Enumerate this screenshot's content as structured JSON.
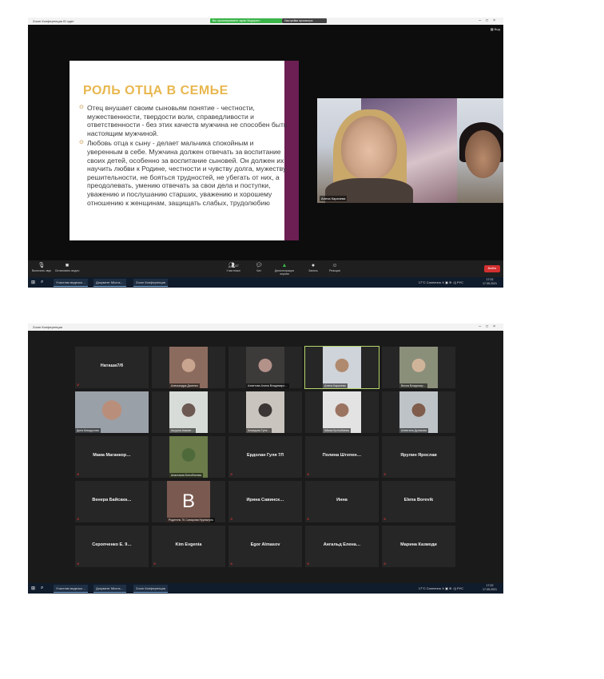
{
  "window1": {
    "title": "Zoom Конференция  ID идет",
    "share_banner": "Вы просматриваете экран Модерато",
    "share_options": "Настройки просмотра",
    "view_label": "Вид",
    "slide": {
      "title": "РОЛЬ ОТЦА В СЕМЬЕ",
      "bullets": [
        "Отец внушает своим сыновьям понятие - честности, мужественности, твердости воли, справедливости и ответственности - без этих качеств мужчина не способен быть настоящим мужчиной.",
        "Любовь отца к сыну - делает мальчика спокойным и уверенным в себе. Мужчина должен отвечать за воспитание своих детей, особенно за воспитание сыновей. Он должен их научить любви к Родине, честности и чувству долга, мужеству, решительности, не бояться трудностей, не убегать от них, а преодолевать, умению отвечать за свои дела и поступки, уважению и послушанию старших, уважению и хорошему отношению к женщинам, защищать слабых, трудолюбию"
      ]
    },
    "video_name": "Алена Карачева",
    "toolbar": {
      "mute": "Включить звук",
      "video": "Остановить видео",
      "participants": "Участники",
      "participants_count": "47",
      "chat": "Чат",
      "share": "Демонстрация экрана",
      "record": "Запись",
      "reactions": "Реакции",
      "end": "Выйти"
    }
  },
  "taskbar": {
    "tasks": [
      "Участник видеоко…",
      "Документ Micros…",
      "Zoom Конференция"
    ],
    "tray": "17°C  Солнечно  ∧  ▣  ⊕  ◁)  РУС",
    "time": "17:02",
    "date": "17.05.2021"
  },
  "window2": {
    "title": "Zoom Конференция",
    "tiles": [
      {
        "name": "Наташа7/б",
        "type": "name"
      },
      {
        "name": "Александра Дасенко",
        "type": "video"
      },
      {
        "name": "Ахметова Алина Владимиро…",
        "type": "video"
      },
      {
        "name": "Алена Карачева",
        "type": "video"
      },
      {
        "name": "Весна Владимир…",
        "type": "video"
      },
      {
        "name": "Дина Шаидулова",
        "type": "video"
      },
      {
        "name": "Ашуров Азамат…",
        "type": "video"
      },
      {
        "name": "Ахмедова Гуля…",
        "type": "video"
      },
      {
        "name": "Айман Куттыбаева",
        "type": "video"
      },
      {
        "name": "Алевтина Дуликова",
        "type": "video"
      },
      {
        "name": "Мама  Маганкор…",
        "type": "name"
      },
      {
        "name": "Анастасия Белобонова",
        "type": "video"
      },
      {
        "name": "Ердолан Гуля 7Л",
        "type": "name"
      },
      {
        "name": "Полина  Штепен…",
        "type": "name"
      },
      {
        "name": "Ярулин Ярослав",
        "type": "name"
      },
      {
        "name": "Венера  Байсака…",
        "type": "name"
      },
      {
        "name": "Родитель 7Б Сапарова Нурлыгуль",
        "type": "avatar",
        "letter": "B"
      },
      {
        "name": "Ирина  Савинск…",
        "type": "name"
      },
      {
        "name": "Инна",
        "type": "name"
      },
      {
        "name": "Elena Borevik",
        "type": "name"
      },
      {
        "name": "Серопченко  Е. 9…",
        "type": "name"
      },
      {
        "name": "Kim Evgenia",
        "type": "name"
      },
      {
        "name": "Egor Almasov",
        "type": "name"
      },
      {
        "name": "Ангальд  Елена…",
        "type": "name"
      },
      {
        "name": "Марина  Казмоди",
        "type": "name"
      }
    ]
  }
}
